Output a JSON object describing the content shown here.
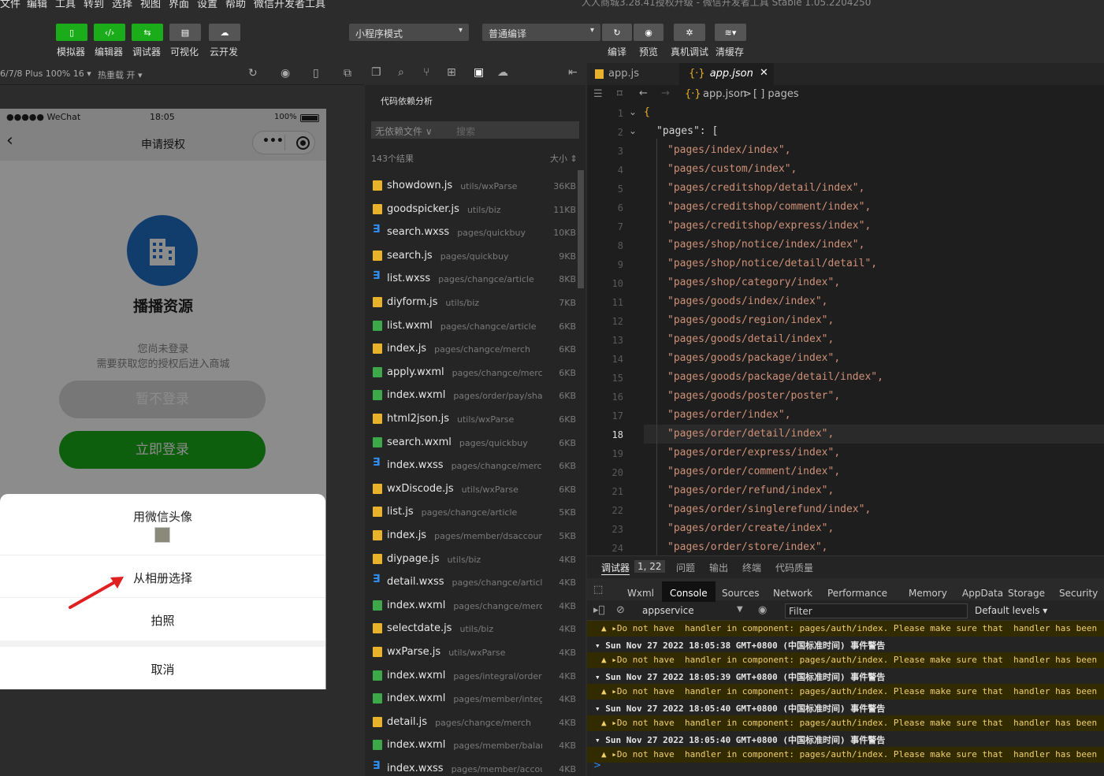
{
  "menu": [
    "文件",
    "编辑",
    "工具",
    "转到",
    "选择",
    "视图",
    "界面",
    "设置",
    "帮助",
    "微信开发者工具"
  ],
  "window_title": "人人商城3.28.41授权升级 - 微信开发者工具 Stable 1.05.2204250",
  "toolbar": {
    "left_buttons": [
      {
        "label": "模拟器",
        "icon": "phone-icon"
      },
      {
        "label": "编辑器",
        "icon": "code-icon"
      },
      {
        "label": "调试器",
        "icon": "debug-icon"
      },
      {
        "label": "可视化",
        "icon": "layout-icon"
      },
      {
        "label": "云开发",
        "icon": "cloud-icon"
      }
    ],
    "mode_select": "小程序模式",
    "compile_select": "普通编译",
    "right_buttons": [
      {
        "label": "编译",
        "icon": "refresh-icon"
      },
      {
        "label": "预览",
        "icon": "eye-icon"
      },
      {
        "label": "真机调试",
        "icon": "bug-icon"
      },
      {
        "label": "清缓存",
        "icon": "layers-icon"
      }
    ]
  },
  "sim_header": {
    "device": "6/7/8 Plus 100% 16 ▾",
    "hot_reload": "热重载 开 ▾"
  },
  "phone": {
    "carrier": "●●●●● WeChat",
    "time": "18:05",
    "battery": "100%",
    "nav_title": "申请授权",
    "app_name": "播播资源",
    "hint1": "您尚未登录",
    "hint2": "需要获取您的授权后进入商城",
    "btn_skip": "暂不登录",
    "btn_login": "立即登录",
    "sheet": {
      "avatar_option": "用微信头像",
      "album": "从相册选择",
      "camera": "拍照",
      "cancel": "取消"
    }
  },
  "file_panel": {
    "title": "代码依赖分析",
    "filter": "无依赖文件 ∨",
    "search_placeholder": "搜索",
    "result_count": "143个结果",
    "sort": "大小 ⇕",
    "files": [
      {
        "name": "showdown.js",
        "path": "utils/wxParse",
        "size": "36KB",
        "type": "js"
      },
      {
        "name": "goodspicker.js",
        "path": "utils/biz",
        "size": "11KB",
        "type": "js"
      },
      {
        "name": "search.wxss",
        "path": "pages/quickbuy",
        "size": "10KB",
        "type": "css"
      },
      {
        "name": "search.js",
        "path": "pages/quickbuy",
        "size": "9KB",
        "type": "js"
      },
      {
        "name": "list.wxss",
        "path": "pages/changce/article",
        "size": "8KB",
        "type": "css"
      },
      {
        "name": "diyform.js",
        "path": "utils/biz",
        "size": "7KB",
        "type": "js"
      },
      {
        "name": "list.wxml",
        "path": "pages/changce/article",
        "size": "6KB",
        "type": "wxml"
      },
      {
        "name": "index.js",
        "path": "pages/changce/merch",
        "size": "6KB",
        "type": "js"
      },
      {
        "name": "apply.wxml",
        "path": "pages/changce/merch",
        "size": "6KB",
        "type": "wxml"
      },
      {
        "name": "index.wxml",
        "path": "pages/order/pay/shar...",
        "size": "6KB",
        "type": "wxml"
      },
      {
        "name": "html2json.js",
        "path": "utils/wxParse",
        "size": "6KB",
        "type": "js"
      },
      {
        "name": "search.wxml",
        "path": "pages/quickbuy",
        "size": "6KB",
        "type": "wxml"
      },
      {
        "name": "index.wxss",
        "path": "pages/changce/merch",
        "size": "6KB",
        "type": "css"
      },
      {
        "name": "wxDiscode.js",
        "path": "utils/wxParse",
        "size": "6KB",
        "type": "js"
      },
      {
        "name": "list.js",
        "path": "pages/changce/article",
        "size": "5KB",
        "type": "js"
      },
      {
        "name": "index.js",
        "path": "pages/member/dsaccounts",
        "size": "5KB",
        "type": "js"
      },
      {
        "name": "diypage.js",
        "path": "utils/biz",
        "size": "4KB",
        "type": "js"
      },
      {
        "name": "detail.wxss",
        "path": "pages/changce/article",
        "size": "4KB",
        "type": "css"
      },
      {
        "name": "index.wxml",
        "path": "pages/changce/merch",
        "size": "4KB",
        "type": "wxml"
      },
      {
        "name": "selectdate.js",
        "path": "utils/biz",
        "size": "4KB",
        "type": "js"
      },
      {
        "name": "wxParse.js",
        "path": "utils/wxParse",
        "size": "4KB",
        "type": "js"
      },
      {
        "name": "index.wxml",
        "path": "pages/integral/order/...",
        "size": "4KB",
        "type": "wxml"
      },
      {
        "name": "index.wxml",
        "path": "pages/member/integ...",
        "size": "4KB",
        "type": "wxml"
      },
      {
        "name": "detail.js",
        "path": "pages/changce/merch",
        "size": "4KB",
        "type": "js"
      },
      {
        "name": "index.wxml",
        "path": "pages/member/balan...",
        "size": "4KB",
        "type": "wxml"
      },
      {
        "name": "index.wxss",
        "path": "pages/member/accou...",
        "size": "4KB",
        "type": "css"
      }
    ]
  },
  "editor": {
    "tabs": [
      {
        "label": "app.js"
      },
      {
        "label": "app.json"
      }
    ],
    "breadcrumb": {
      "file": "app.json",
      "sep": ">",
      "node": "[ ] pages"
    },
    "active_line": "18",
    "lines": [
      {
        "n": "1",
        "text": "{"
      },
      {
        "n": "2",
        "text": "\"pages\": ["
      },
      {
        "n": "3",
        "text": "\"pages/index/index\","
      },
      {
        "n": "4",
        "text": "\"pages/custom/index\","
      },
      {
        "n": "5",
        "text": "\"pages/creditshop/detail/index\","
      },
      {
        "n": "6",
        "text": "\"pages/creditshop/comment/index\","
      },
      {
        "n": "7",
        "text": "\"pages/creditshop/express/index\","
      },
      {
        "n": "8",
        "text": "\"pages/shop/notice/index/index\","
      },
      {
        "n": "9",
        "text": "\"pages/shop/notice/detail/detail\","
      },
      {
        "n": "10",
        "text": "\"pages/shop/category/index\","
      },
      {
        "n": "11",
        "text": "\"pages/goods/index/index\","
      },
      {
        "n": "12",
        "text": "\"pages/goods/region/index\","
      },
      {
        "n": "13",
        "text": "\"pages/goods/detail/index\","
      },
      {
        "n": "14",
        "text": "\"pages/goods/package/index\","
      },
      {
        "n": "15",
        "text": "\"pages/goods/package/detail/index\","
      },
      {
        "n": "16",
        "text": "\"pages/goods/poster/poster\","
      },
      {
        "n": "17",
        "text": "\"pages/order/index\","
      },
      {
        "n": "18",
        "text": "\"pages/order/detail/index\","
      },
      {
        "n": "19",
        "text": "\"pages/order/express/index\","
      },
      {
        "n": "20",
        "text": "\"pages/order/comment/index\","
      },
      {
        "n": "21",
        "text": "\"pages/order/refund/index\","
      },
      {
        "n": "22",
        "text": "\"pages/order/singlerefund/index\","
      },
      {
        "n": "23",
        "text": "\"pages/order/create/index\","
      },
      {
        "n": "24",
        "text": "\"pages/order/store/index\","
      }
    ]
  },
  "debug": {
    "tabs": [
      "调试器",
      "1, 22",
      "问题",
      "输出",
      "终端",
      "代码质量"
    ],
    "console_tabs": [
      "Wxml",
      "Console",
      "Sources",
      "Network",
      "Performance",
      "Memory",
      "AppData",
      "Storage",
      "Security"
    ],
    "context": "appservice",
    "filter_placeholder": "Filter",
    "levels": "Default levels ▾",
    "logs": [
      {
        "kind": "warn",
        "text": "▲ ▸Do not have  handler in component: pages/auth/index. Please make sure that  handler has been"
      },
      {
        "kind": "hdr",
        "text": "▾ Sun Nov 27 2022 18:05:38 GMT+0800 (中国标准时间) 事件警告"
      },
      {
        "kind": "warn",
        "text": "▲ ▸Do not have  handler in component: pages/auth/index. Please make sure that  handler has been"
      },
      {
        "kind": "hdr",
        "text": "▾ Sun Nov 27 2022 18:05:39 GMT+0800 (中国标准时间) 事件警告"
      },
      {
        "kind": "warn",
        "text": "▲ ▸Do not have  handler in component: pages/auth/index. Please make sure that  handler has been"
      },
      {
        "kind": "hdr",
        "text": "▾ Sun Nov 27 2022 18:05:40 GMT+0800 (中国标准时间) 事件警告"
      },
      {
        "kind": "warn",
        "text": "▲ ▸Do not have  handler in component: pages/auth/index. Please make sure that  handler has been"
      },
      {
        "kind": "hdr",
        "text": "▾ Sun Nov 27 2022 18:05:40 GMT+0800 (中国标准时间) 事件警告"
      },
      {
        "kind": "warn",
        "text": "▲ ▸Do not have  handler in component: pages/auth/index. Please make sure that  handler has been"
      }
    ],
    "prompt": ">"
  }
}
